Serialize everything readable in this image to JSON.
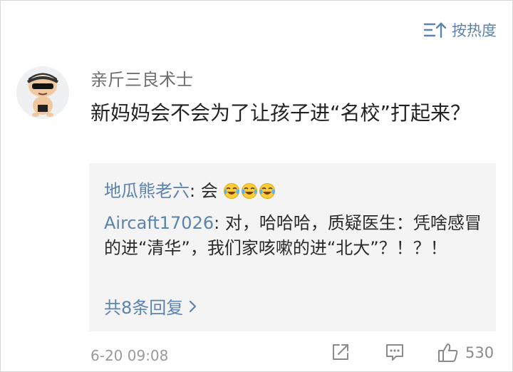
{
  "header": {
    "sort_label": "按热度",
    "sort_icon": "sort-up-icon"
  },
  "comment": {
    "username": "亲斤三良术士",
    "text": "新妈妈会不会为了让孩子进“名校”打起来？",
    "timestamp": "6-20 09:08",
    "like_count": "530",
    "icons": [
      "share-icon",
      "comment-icon",
      "thumbs-up-icon"
    ]
  },
  "replies": [
    {
      "author": "地瓜熊老六",
      "sep": ": ",
      "text": "会",
      "emoji": [
        "laugh-cry-emoji",
        "laugh-cry-emoji",
        "laugh-cry-emoji"
      ]
    },
    {
      "author": "Aircaft17026",
      "sep": ": ",
      "text": "对，哈哈哈，质疑医生：凭啥感冒的进“清华”，我们家咳嗽的进“北大”？！？！"
    }
  ],
  "more_replies": {
    "label": "共8条回复",
    "icon": "chevron-right-icon"
  },
  "colors": {
    "link": "#5c83ad",
    "reply_bg": "#f4f4f4",
    "text": "#222222",
    "muted": "#9a9a9a"
  }
}
